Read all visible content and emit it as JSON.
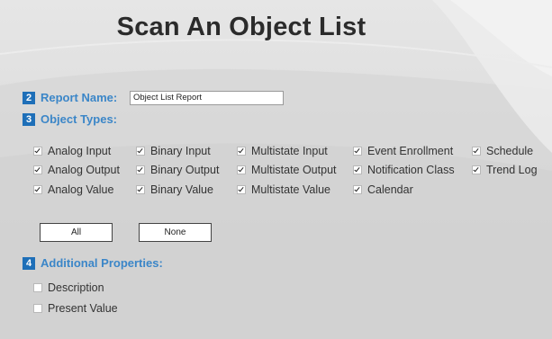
{
  "page": {
    "title": "Scan An Object List"
  },
  "report_name": {
    "number": "2",
    "label": "Report Name:",
    "value": "Object List Report"
  },
  "object_types": {
    "number": "3",
    "label": "Object Types:",
    "items": [
      {
        "label": "Analog Input",
        "checked": true
      },
      {
        "label": "Binary Input",
        "checked": true
      },
      {
        "label": "Multistate Input",
        "checked": true
      },
      {
        "label": "Event Enrollment",
        "checked": true
      },
      {
        "label": "Schedule",
        "checked": true
      },
      {
        "label": "Analog Output",
        "checked": true
      },
      {
        "label": "Binary Output",
        "checked": true
      },
      {
        "label": "Multistate Output",
        "checked": true
      },
      {
        "label": "Notification Class",
        "checked": true
      },
      {
        "label": "Trend Log",
        "checked": true
      },
      {
        "label": "Analog Value",
        "checked": true
      },
      {
        "label": "Binary Value",
        "checked": true
      },
      {
        "label": "Multistate Value",
        "checked": true
      },
      {
        "label": "Calendar",
        "checked": true
      }
    ],
    "all_button": "All",
    "none_button": "None"
  },
  "additional_properties": {
    "number": "4",
    "label": "Additional Properties:",
    "items": [
      {
        "label": "Description",
        "checked": false
      },
      {
        "label": "Present Value",
        "checked": false
      }
    ]
  },
  "colors": {
    "accent": "#1e6fb8",
    "section_label": "#3b86c8",
    "title": "#2b2b2b"
  }
}
